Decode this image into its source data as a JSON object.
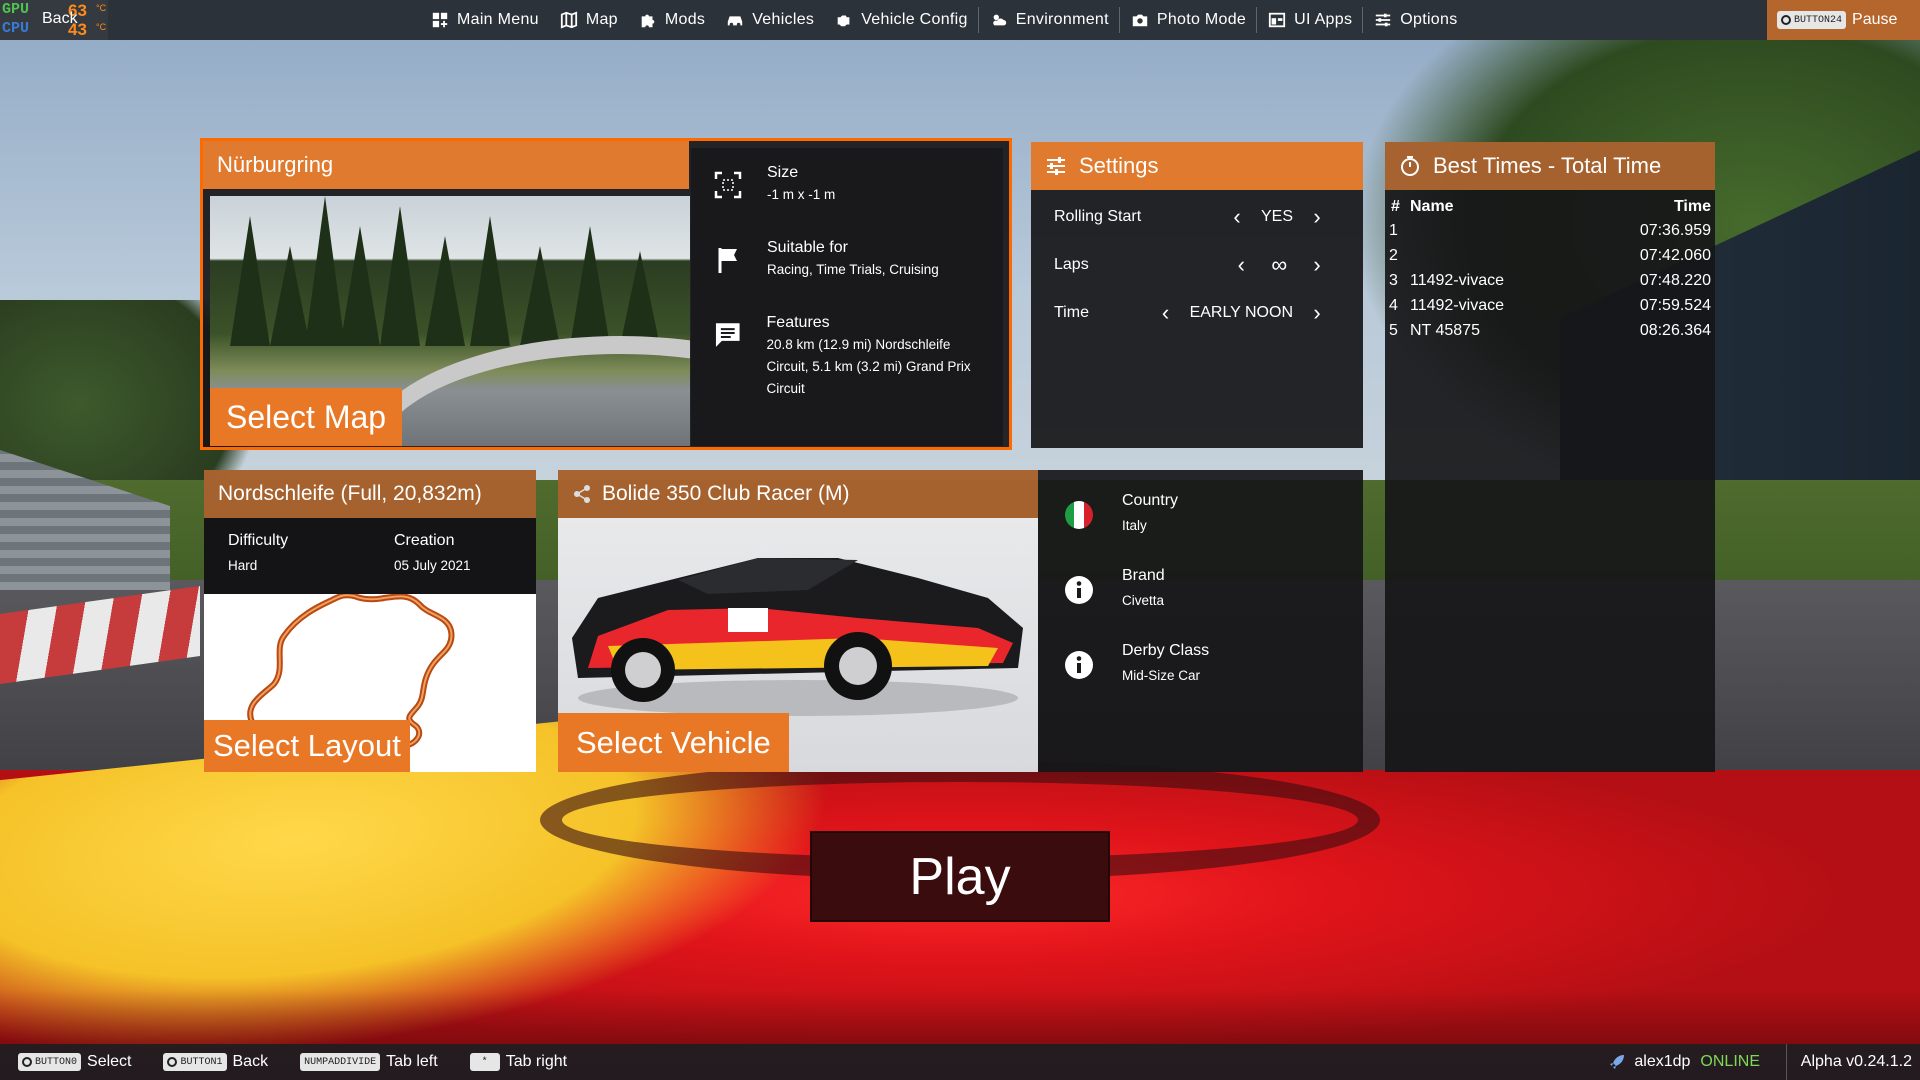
{
  "perf": {
    "gpu_label": "GPU",
    "cpu_label": "CPU",
    "gpu_temp": "63",
    "cpu_temp": "43",
    "unit": "°C"
  },
  "topbar": {
    "back_label": "Back",
    "menu": [
      {
        "label": "Main Menu",
        "icon": "grid-plus-icon"
      },
      {
        "label": "Map",
        "icon": "map-icon"
      },
      {
        "label": "Mods",
        "icon": "puzzle-icon"
      },
      {
        "label": "Vehicles",
        "icon": "car-icon"
      },
      {
        "label": "Vehicle Config",
        "icon": "engine-icon"
      },
      {
        "label": "Environment",
        "icon": "weather-icon"
      },
      {
        "label": "Photo Mode",
        "icon": "camera-icon"
      },
      {
        "label": "UI Apps",
        "icon": "apps-icon"
      },
      {
        "label": "Options",
        "icon": "sliders-icon"
      }
    ],
    "pause_badge": "BUTTON24",
    "pause_label": "Pause"
  },
  "map_panel": {
    "title": "Nürburgring",
    "select_label": "Select Map",
    "size_title": "Size",
    "size_value": "-1 m x -1 m",
    "suitable_title": "Suitable for",
    "suitable_value": "Racing, Time Trials, Cruising",
    "features_title": "Features",
    "features_value": "20.8 km (12.9 mi) Nordschleife Circuit, 5.1 km (3.2 mi) Grand Prix Circuit"
  },
  "settings": {
    "title": "Settings",
    "rows": [
      {
        "name": "Rolling Start",
        "value": "YES"
      },
      {
        "name": "Laps",
        "value": "∞"
      },
      {
        "name": "Time",
        "value": "EARLY NOON"
      }
    ]
  },
  "best_times": {
    "title": "Best Times - Total Time",
    "col_num": "#",
    "col_name": "Name",
    "col_time": "Time",
    "rows": [
      {
        "n": "1",
        "name": "",
        "time": "07:36.959"
      },
      {
        "n": "2",
        "name": "",
        "time": "07:42.060"
      },
      {
        "n": "3",
        "name": "11492-vivace",
        "time": "07:48.220"
      },
      {
        "n": "4",
        "name": "11492-vivace",
        "time": "07:59.524"
      },
      {
        "n": "5",
        "name": "NT 45875",
        "time": "08:26.364"
      }
    ]
  },
  "layout_panel": {
    "title": "Nordschleife (Full, 20,832m)",
    "difficulty_title": "Difficulty",
    "difficulty_value": "Hard",
    "creation_title": "Creation",
    "creation_value": "05 July 2021",
    "select_label": "Select Layout"
  },
  "vehicle_panel": {
    "title": "Bolide 350 Club Racer (M)",
    "select_label": "Select Vehicle",
    "country_title": "Country",
    "country_value": "Italy",
    "brand_title": "Brand",
    "brand_value": "Civetta",
    "class_title": "Derby Class",
    "class_value": "Mid-Size Car"
  },
  "play_label": "Play",
  "bottombar": {
    "hints": [
      {
        "badge": "BUTTON0",
        "label": "Select"
      },
      {
        "badge": "BUTTON1",
        "label": "Back"
      },
      {
        "badge": "NUMPADDIVIDE",
        "label": "Tab left"
      },
      {
        "badge": "*",
        "label": "Tab right"
      }
    ],
    "username": "alex1dp",
    "status": "ONLINE",
    "version": "Alpha v0.24.1.2"
  },
  "colors": {
    "accent": "#e07a2e",
    "online": "#7ed957",
    "play_bg": "#3a0c0e"
  }
}
